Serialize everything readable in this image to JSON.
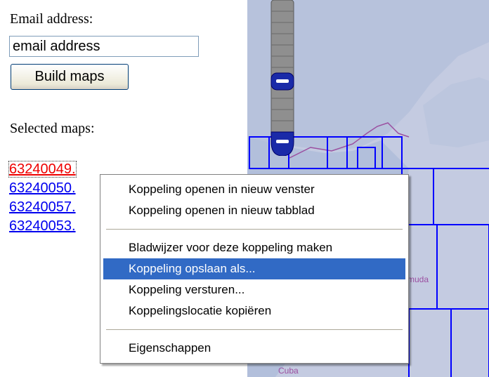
{
  "form": {
    "email_label": "Email address:",
    "email_value": "email address",
    "build_button": "Build maps",
    "selected_label": "Selected maps:"
  },
  "maps": [
    {
      "label": "63240049.",
      "state": "visited-focused"
    },
    {
      "label": "63240050.",
      "state": "link"
    },
    {
      "label": "63240057.",
      "state": "link"
    },
    {
      "label": "63240053.",
      "state": "link"
    }
  ],
  "map_view": {
    "labels": {
      "bermuda": "rmuda",
      "cuba": "Cuba"
    },
    "colors": {
      "water": "#c4cbe1",
      "land": "#aebcd8",
      "grid": "#0000ff",
      "border": "#9b4fa0"
    }
  },
  "context_menu": {
    "groups": [
      [
        {
          "label": "Koppeling openen in nieuw venster",
          "active": false
        },
        {
          "label": "Koppeling openen in nieuw tabblad",
          "active": false
        }
      ],
      [
        {
          "label": "Bladwijzer voor deze koppeling maken",
          "active": false
        },
        {
          "label": "Koppeling opslaan als...",
          "active": true
        },
        {
          "label": "Koppeling versturen...",
          "active": false
        },
        {
          "label": "Koppelingslocatie kopiëren",
          "active": false
        }
      ],
      [
        {
          "label": "Eigenschappen",
          "active": false
        }
      ]
    ]
  }
}
